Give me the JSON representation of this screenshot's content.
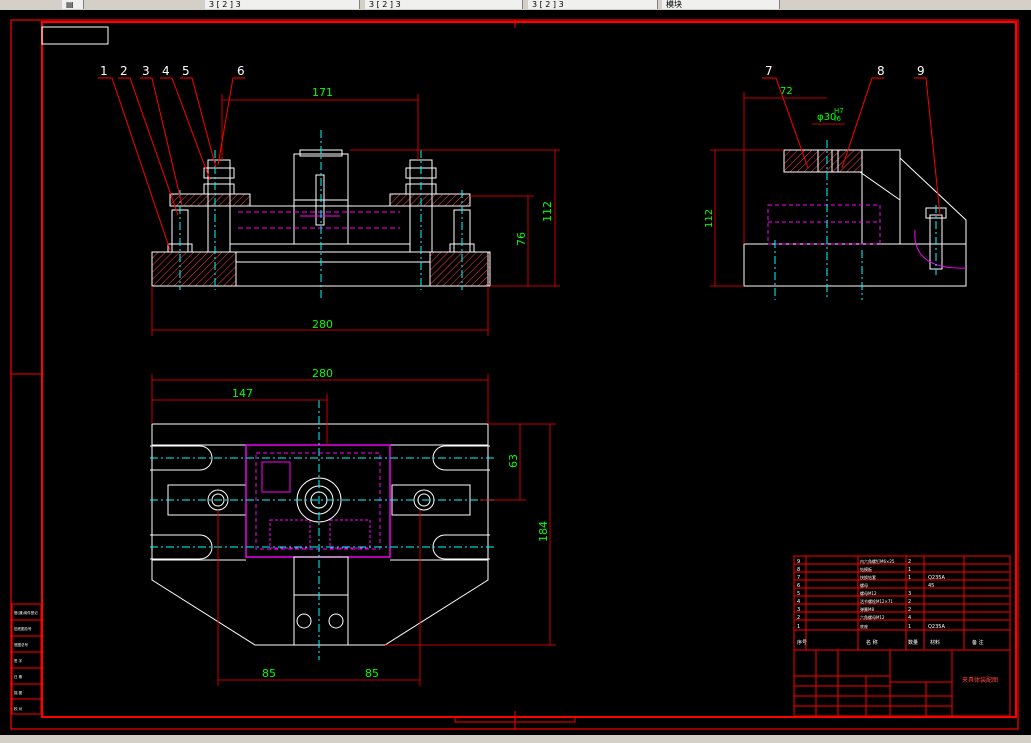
{
  "tabs": [
    {
      "label": "",
      "icon": "document-icon"
    },
    {
      "label": "3 [ 2 ] 3"
    },
    {
      "label": "3 [ 2 ] 3"
    },
    {
      "label": "3 [ 2 ] 3"
    },
    {
      "label": "模块"
    }
  ],
  "colors": {
    "frame": "#ff0000",
    "geometry": "#ffffff",
    "dimension": "#00ff00",
    "dim_text": "#00ff00",
    "hidden": "#ff00ff",
    "center": "#00ffff",
    "leader": "#ff0000",
    "hatch": "#ff4040"
  },
  "balloons": [
    "1",
    "2",
    "3",
    "4",
    "5",
    "6",
    "7",
    "8",
    "9"
  ],
  "dimensions": {
    "front_top_width": "171",
    "front_total_width": "280",
    "front_height_outer": "112",
    "front_height_inner": "76",
    "side_width": "72",
    "side_height": "112",
    "side_fit": "φ30",
    "side_fit_tol_top": "H7",
    "side_fit_tol_bottom": "f6",
    "top_total_width": "280",
    "top_partial_width": "147",
    "top_small_height": "63",
    "top_total_height": "184",
    "top_bottom_left": "85",
    "top_bottom_right": "85"
  },
  "bom": {
    "rows": [
      {
        "no": "9",
        "name": "内六角螺钉M6×25",
        "qty": "2",
        "material": ""
      },
      {
        "no": "8",
        "name": "钻模板",
        "qty": "1",
        "material": ""
      },
      {
        "no": "7",
        "name": "快换钻套",
        "qty": "1",
        "material": "Q235A"
      },
      {
        "no": "6",
        "name": "螺母",
        "qty": "",
        "material": "45"
      },
      {
        "no": "5",
        "name": "螺母M12",
        "qty": "3",
        "material": ""
      },
      {
        "no": "4",
        "name": "活节螺栓M12×71",
        "qty": "2",
        "material": ""
      },
      {
        "no": "3",
        "name": "弹簧M8",
        "qty": "2",
        "material": ""
      },
      {
        "no": "2",
        "name": "六角螺母M12",
        "qty": "4",
        "material": ""
      },
      {
        "no": "1",
        "name": "底座",
        "qty": "1",
        "material": "Q235A"
      }
    ],
    "header": [
      "序号",
      "名 称",
      "数量",
      "材料",
      "备 注"
    ],
    "title": "夹具体装配图"
  },
  "left_stamp": [
    "借(通)用件登记",
    "旧底图总号",
    "底图总号",
    "签 字",
    "日 期",
    "描 图",
    "校 对"
  ]
}
